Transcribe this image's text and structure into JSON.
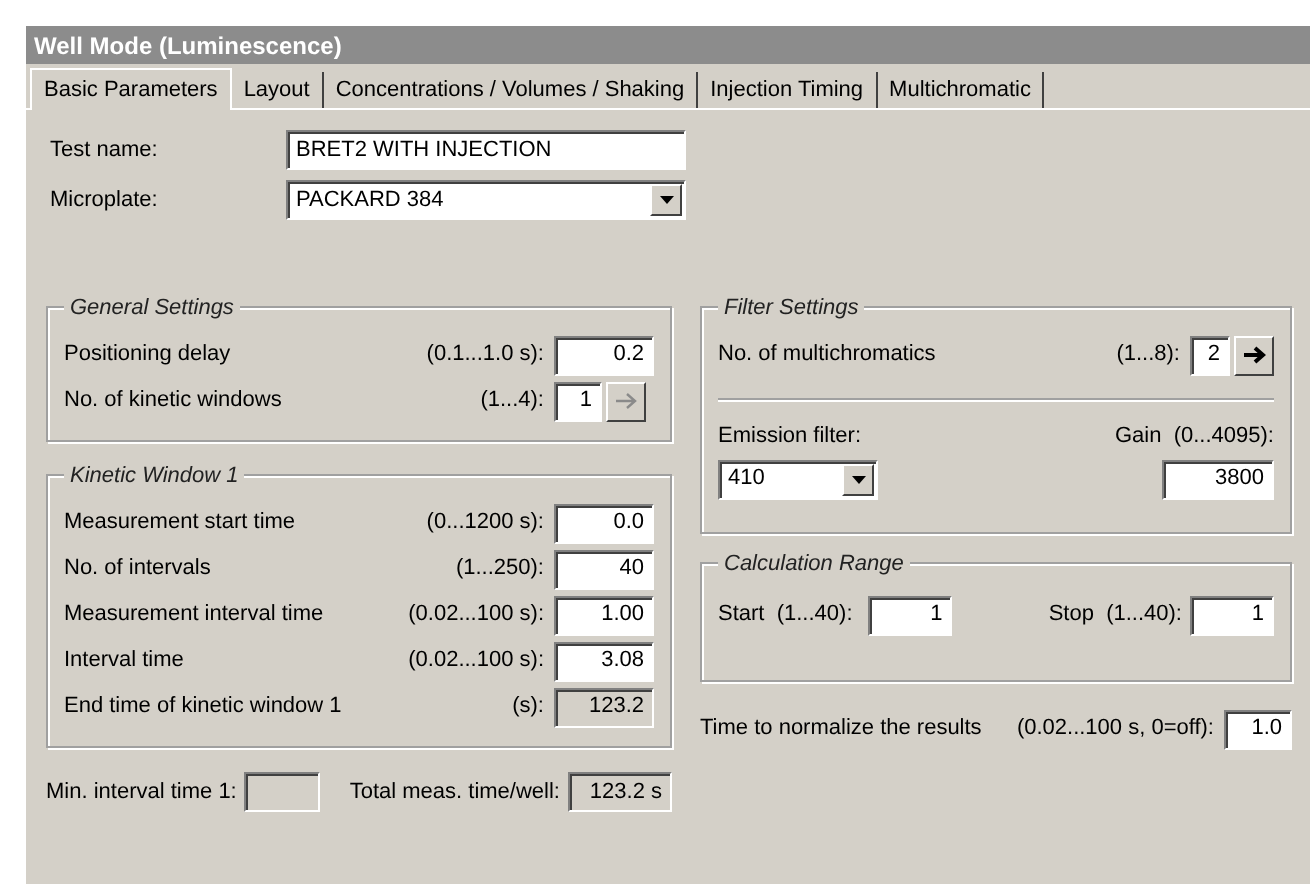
{
  "window": {
    "title": "Well Mode (Luminescence)"
  },
  "tabs": [
    {
      "label": "Basic Parameters",
      "selected": true
    },
    {
      "label": "Layout",
      "selected": false
    },
    {
      "label": "Concentrations / Volumes / Shaking",
      "selected": false
    },
    {
      "label": "Injection Timing",
      "selected": false
    },
    {
      "label": "Multichromatic",
      "selected": false
    }
  ],
  "test_name": {
    "label": "Test name:",
    "value": "BRET2 WITH INJECTION"
  },
  "microplate": {
    "label": "Microplate:",
    "value": "PACKARD 384"
  },
  "general_settings": {
    "title": "General Settings",
    "rows": [
      {
        "kind": "field",
        "label": "Positioning delay",
        "range": "(0.1...1.0 s):",
        "value": "0.2"
      },
      {
        "kind": "stepper",
        "label": "No. of kinetic windows",
        "range": "(1...4):",
        "value": "1",
        "disabled": true
      }
    ]
  },
  "kinetic_window": {
    "title": "Kinetic Window 1",
    "rows": [
      {
        "kind": "field",
        "label": "Measurement start time",
        "range": "(0...1200 s):",
        "value": "0.0"
      },
      {
        "kind": "field",
        "label": "No. of intervals",
        "range": "(1...250):",
        "value": "40"
      },
      {
        "kind": "field",
        "label": "Measurement interval time",
        "range": "(0.02...100 s):",
        "value": "1.00"
      },
      {
        "kind": "field",
        "label": "Interval time",
        "range": "(0.02...100 s):",
        "value": "3.08"
      },
      {
        "kind": "readonly",
        "label": "End time of kinetic window 1",
        "range": "(s):",
        "value": "123.2"
      }
    ]
  },
  "min_interval": {
    "label": "Min. interval time 1:"
  },
  "total_time": {
    "label": "Total meas. time/well:",
    "value": "123.2 s"
  },
  "filter_settings": {
    "title": "Filter Settings",
    "multichromatics": {
      "label": "No. of multichromatics",
      "range": "(1...8):",
      "value": "2",
      "disabled": false
    },
    "emission_filter": {
      "label": "Emission filter:",
      "value": "410"
    },
    "gain": {
      "label": "Gain  (0...4095):",
      "value": "3800"
    }
  },
  "calculation_range": {
    "title": "Calculation Range",
    "start": {
      "label": "Start  (1...40):",
      "value": "1"
    },
    "stop": {
      "label": "Stop  (1...40):",
      "value": "1"
    }
  },
  "normalize": {
    "label": "Time to normalize the results",
    "range": "(0.02...100 s, 0=off):",
    "value": "1.0"
  }
}
